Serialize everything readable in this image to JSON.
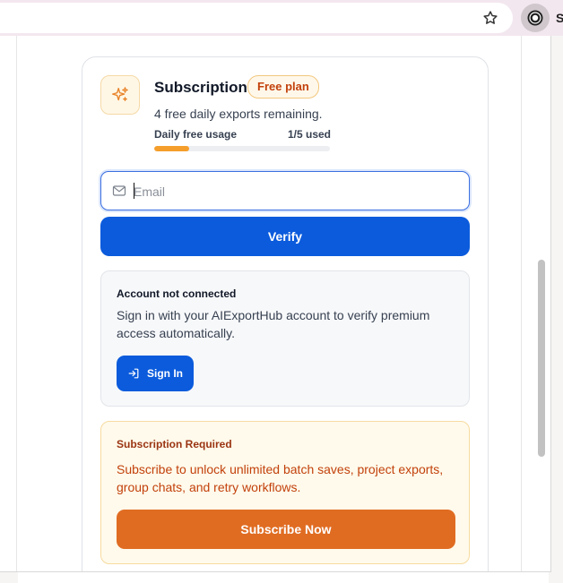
{
  "browser": {
    "star_icon": "star-outline-icon",
    "extension_icon": "extension-badge-icon",
    "partial_text": "S"
  },
  "subscription": {
    "title": "Subscription",
    "plan_badge": "Free plan",
    "remaining": "4 free daily exports remaining.",
    "usage_label": "Daily free usage",
    "usage_count": "1/5 used",
    "usage_fraction": 0.2,
    "accent_color": "#f59e2b"
  },
  "email": {
    "placeholder": "Email",
    "value": ""
  },
  "verify": {
    "label": "Verify",
    "color": "#0b5bdc"
  },
  "account": {
    "title": "Account not connected",
    "description": "Sign in with your AIExportHub account to verify premium access automatically.",
    "signin_label": "Sign In"
  },
  "required": {
    "title": "Subscription Required",
    "description": "Subscribe to unlock unlimited batch saves, project exports, group chats, and retry workflows.",
    "subscribe_label": "Subscribe Now",
    "color": "#e06c22"
  }
}
